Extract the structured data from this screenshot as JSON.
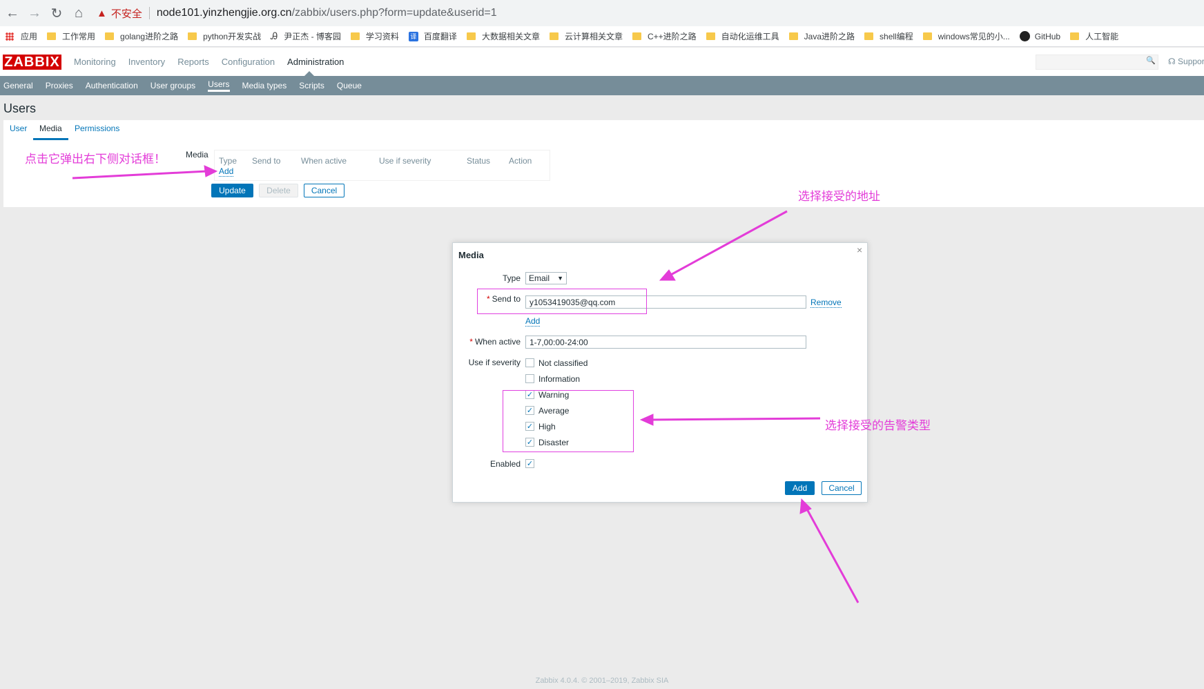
{
  "browser": {
    "warning": "不安全",
    "url_host": "node101.yinzhengjie.org.cn",
    "url_path": "/zabbix/users.php?form=update&userid=1",
    "bookmarks": [
      "应用",
      "工作常用",
      "golang进阶之路",
      "python开发实战",
      "尹正杰 - 博客园",
      "学习资料",
      "百度翻译",
      "大数据相关文章",
      "云计算相关文章",
      "C++进阶之路",
      "自动化运维工具",
      "Java进阶之路",
      "shell编程",
      "windows常见的小...",
      "GitHub",
      "人工智能"
    ]
  },
  "header": {
    "logo": "ZABBIX",
    "menu": [
      "Monitoring",
      "Inventory",
      "Reports",
      "Configuration",
      "Administration"
    ],
    "support": "Suppor"
  },
  "submenu": [
    "General",
    "Proxies",
    "Authentication",
    "User groups",
    "Users",
    "Media types",
    "Scripts",
    "Queue"
  ],
  "page": {
    "title": "Users",
    "tabs": [
      "User",
      "Media",
      "Permissions"
    ],
    "media_label": "Media",
    "columns": [
      "Type",
      "Send to",
      "When active",
      "Use if severity",
      "Status",
      "Action"
    ],
    "add_link": "Add",
    "buttons": {
      "update": "Update",
      "delete": "Delete",
      "cancel": "Cancel"
    }
  },
  "modal": {
    "title": "Media",
    "type_label": "Type",
    "type_value": "Email",
    "sendto_label": "Send to",
    "sendto_value": "y1053419035@qq.com",
    "remove": "Remove",
    "add_link": "Add",
    "when_label": "When active",
    "when_value": "1-7,00:00-24:00",
    "severity_label": "Use if severity",
    "severities": [
      {
        "label": "Not classified",
        "checked": false
      },
      {
        "label": "Information",
        "checked": false
      },
      {
        "label": "Warning",
        "checked": true
      },
      {
        "label": "Average",
        "checked": true
      },
      {
        "label": "High",
        "checked": true
      },
      {
        "label": "Disaster",
        "checked": true
      }
    ],
    "enabled_label": "Enabled",
    "add_button": "Add",
    "cancel_button": "Cancel"
  },
  "annotations": {
    "click_hint": "点击它弹出右下侧对话框！",
    "address_hint": "选择接受的地址",
    "severity_hint": "选择接受的告警类型"
  },
  "footer": "Zabbix 4.0.4. © 2001–2019, Zabbix SIA",
  "colors": {
    "accent": "#0275b8",
    "annotation": "#e33cd8",
    "logo": "#d40000",
    "submenu": "#768d99"
  }
}
